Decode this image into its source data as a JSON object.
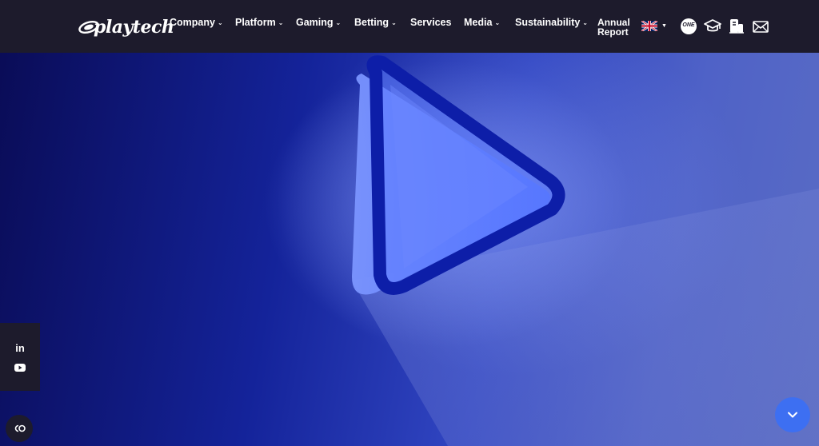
{
  "brand": {
    "logo_text": "playtech"
  },
  "nav": {
    "items": [
      {
        "label": "Company",
        "has_dropdown": true
      },
      {
        "label": "Platform",
        "has_dropdown": true
      },
      {
        "label": "Gaming",
        "has_dropdown": true
      },
      {
        "label": "Betting",
        "has_dropdown": true
      },
      {
        "label": "Services",
        "has_dropdown": false
      },
      {
        "label": "Media",
        "has_dropdown": true
      },
      {
        "label": "Sustainability",
        "has_dropdown": true
      }
    ],
    "annual_report": {
      "line1": "Annual",
      "line2": "Report"
    },
    "chevron": "⌄"
  },
  "utility_icons": [
    {
      "name": "uk-flag-icon",
      "label": "Language selector"
    },
    {
      "name": "one-logo-icon",
      "label": "ONE"
    },
    {
      "name": "graduation-cap-icon",
      "label": "Academy"
    },
    {
      "name": "careers-icon",
      "label": "Careers"
    },
    {
      "name": "mail-icon",
      "label": "Contact"
    }
  ],
  "one_badge": "ONE",
  "social": [
    {
      "name": "linkedin-icon",
      "label": "in"
    },
    {
      "name": "youtube-icon",
      "label": "YouTube"
    }
  ],
  "colors": {
    "header_bg": "#1d1b2c",
    "accent_blue": "#3d6ff2",
    "hero_dark": "#0a0c57",
    "hero_light": "#5a6cc4"
  }
}
